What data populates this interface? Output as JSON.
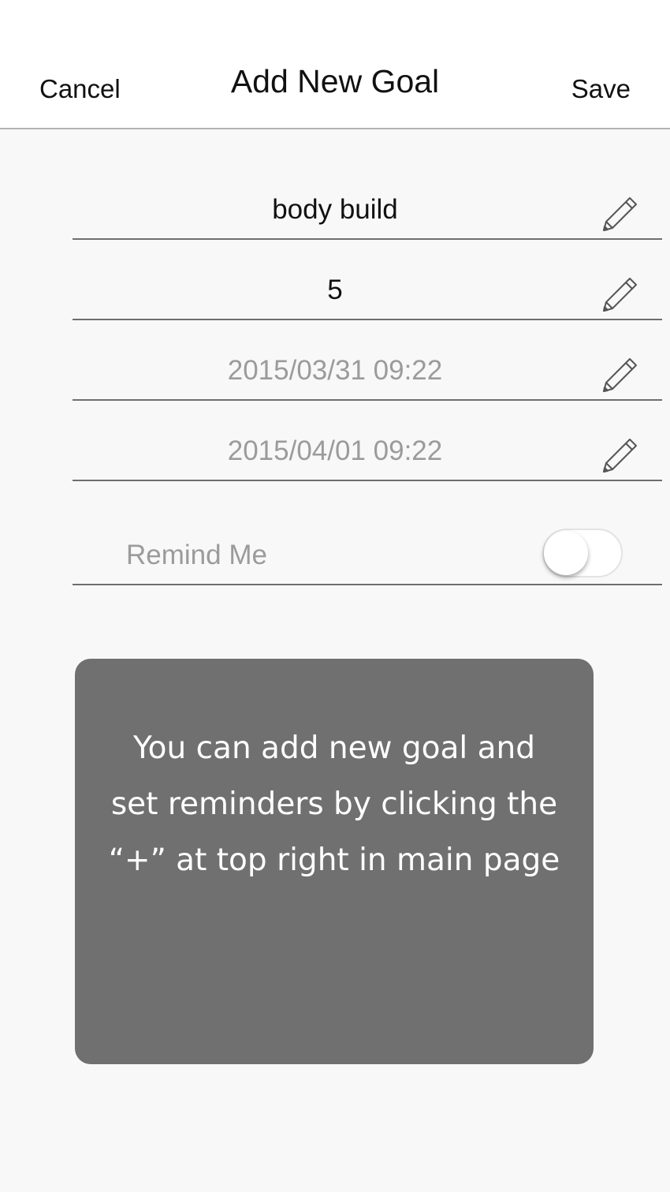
{
  "header": {
    "cancel_label": "Cancel",
    "title": "Add New Goal",
    "save_label": "Save"
  },
  "fields": [
    {
      "value": "body build",
      "icon": "pencil-icon"
    },
    {
      "value": "5",
      "icon": "pencil-icon"
    },
    {
      "value": "2015/03/31 09:22",
      "icon": "pencil-icon"
    },
    {
      "value": "2015/04/01 09:22",
      "icon": "pencil-icon"
    }
  ],
  "remind": {
    "label": "Remind Me",
    "enabled": false
  },
  "tip": {
    "lines": [
      "You can add new goal and",
      "set reminders by clicking the",
      "“+” at top right in main page"
    ]
  },
  "colors": {
    "background": "#f8f8f8",
    "tip_card": "#707070",
    "muted_text": "#9b9b9b",
    "divider": "#6e6e6e"
  }
}
